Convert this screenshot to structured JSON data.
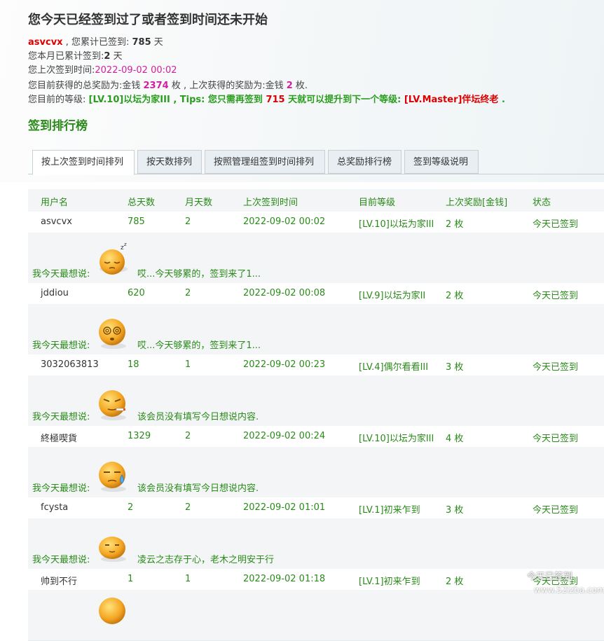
{
  "header": {
    "title": "您今天已经签到过了或者签到时间还未开始",
    "username": "asvcvx",
    "total_prefix": " , 您累计已签到: ",
    "total_days": "785",
    "total_suffix": " 天",
    "month_prefix": "您本月已累计签到:",
    "month_days": "2",
    "month_suffix": " 天",
    "last_prefix": "您上次签到时间:",
    "last_time": "2022-09-02 00:02",
    "reward_prefix": "您目前获得的总奖励为:金钱 ",
    "reward_total": "2374",
    "reward_mid": " 枚 , 上次获得的奖励为:金钱 ",
    "reward_last": "2",
    "reward_suffix": " 枚.",
    "level_prefix": "您目前的等级: ",
    "level_current": "[LV.10]以坛为家III , Tips: 您只需再签到 ",
    "level_days": "715",
    "level_mid": " 天就可以提升到下一个等级: ",
    "level_next": "[LV.Master]伴坛终老",
    "level_end": " ."
  },
  "ranking": {
    "title": "签到排行榜",
    "tabs": [
      "按上次签到时间排列",
      "按天数排列",
      "按照管理组签到时间排列",
      "总奖励排行榜",
      "签到等级说明"
    ],
    "columns": [
      "用户名",
      "总天数",
      "月天数",
      "上次签到时间",
      "目前等级",
      "上次奖励[金钱]",
      "状态"
    ],
    "say_label": "我今天最想说:",
    "rows": [
      {
        "name": "asvcvx",
        "total": "785",
        "month": "2",
        "time": "2022-09-02 00:02",
        "level": "[LV.10]以坛为家III",
        "reward": "2 枚",
        "status": "今天已签到",
        "say": "哎...今天够累的，签到来了1...",
        "face": "sleepy-face-icon"
      },
      {
        "name": "jddiou",
        "total": "620",
        "month": "2",
        "time": "2022-09-02 00:08",
        "level": "[LV.9]以坛为家II",
        "reward": "2 枚",
        "status": "今天已签到",
        "say": "哎...今天够累的，签到来了1...",
        "face": "dizzy-face-icon"
      },
      {
        "name": "3032063813",
        "total": "18",
        "month": "1",
        "time": "2022-09-02 00:23",
        "level": "[LV.4]偶尔看看III",
        "reward": "3 枚",
        "status": "今天已签到",
        "say": "该会员没有填写今日想说内容.",
        "face": "smoking-face-icon"
      },
      {
        "name": "終極喫貨",
        "total": "1329",
        "month": "2",
        "time": "2022-09-02 00:24",
        "level": "[LV.10]以坛为家III",
        "reward": "4 枚",
        "status": "今天已签到",
        "say": "该会员没有填写今日想说内容.",
        "face": "sweat-face-icon"
      },
      {
        "name": "fcysta",
        "total": "2",
        "month": "2",
        "time": "2022-09-02 01:01",
        "level": "[LV.1]初来乍到",
        "reward": "3 枚",
        "status": "今天已签到",
        "say": "凌云之志存于心，老木之明安于行",
        "face": "content-face-icon"
      },
      {
        "name": "帅到不行",
        "total": "1",
        "month": "1",
        "time": "2022-09-02 01:18",
        "level": "[LV.1]初来乍到",
        "reward": "2 枚",
        "status": "今天已签到",
        "say": "",
        "face": "smile-face-icon"
      }
    ]
  },
  "watermark": {
    "line1": "今天已签到",
    "line2": "www.52lzba.com"
  },
  "colors": {
    "accent_green": "#2a8a1a",
    "highlight_red": "#dd0000",
    "highlight_magenta": "#d020a0",
    "face_orange": "#f5a623"
  }
}
